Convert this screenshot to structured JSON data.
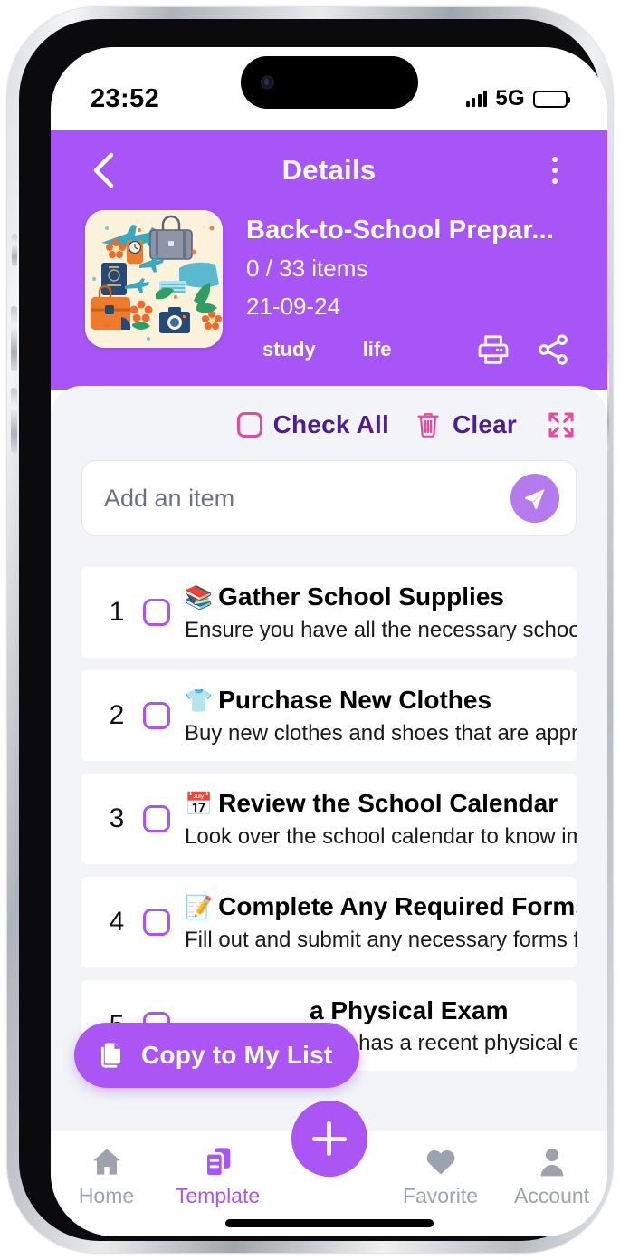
{
  "status_bar": {
    "time": "23:52",
    "network": "5G",
    "signal_icon": "signal-bars-icon",
    "battery_icon": "battery-full-icon"
  },
  "header": {
    "back_icon": "chevron-left-icon",
    "title": "Details",
    "menu_icon": "more-vertical-icon",
    "accent_color": "#a855f7"
  },
  "template": {
    "thumbnail_icon": "travel-pattern-thumbnail",
    "title": "Back-to-School Prepar...",
    "count": "0  / 33 items",
    "date": "21-09-24",
    "tags": [
      "study",
      "life"
    ],
    "print_icon": "printer-icon",
    "share_icon": "share-icon"
  },
  "toolbar": {
    "check_all_label": "Check All",
    "check_all_icon": "checkbox-empty-icon",
    "clear_label": "Clear",
    "clear_icon": "trash-icon",
    "expand_icon": "expand-fullscreen-icon",
    "accent_color": "#ec4899",
    "label_color": "#4c1d95"
  },
  "add_item": {
    "placeholder": "Add an item",
    "value": "",
    "send_icon": "send-paper-plane-icon"
  },
  "items": [
    {
      "num": "1",
      "emoji": "📚",
      "title": "Gather School Supplies",
      "desc": "Ensure you have all the necessary school supplies",
      "checked": false
    },
    {
      "num": "2",
      "emoji": "👕",
      "title": "Purchase New Clothes",
      "desc": "Buy new clothes and shoes that are appropriate fo",
      "checked": false
    },
    {
      "num": "3",
      "emoji": "📅",
      "title": "Review the School Calendar",
      "desc": "Look over the school calendar to know important",
      "checked": false
    },
    {
      "num": "4",
      "emoji": "📝",
      "title": "Complete Any Required Forms",
      "desc": "Fill out and submit any necessary forms for enrollm",
      "checked": false
    },
    {
      "num": "5",
      "emoji": "",
      "title": "a Physical Exam",
      "desc": "Ensure your child has a recent physical exam and",
      "checked": false
    }
  ],
  "copy_button": {
    "label": "Copy to My List",
    "icon": "copy-icon"
  },
  "tabbar": {
    "tabs": [
      {
        "label": "Home",
        "icon": "home-icon",
        "active": false
      },
      {
        "label": "Template",
        "icon": "template-icon",
        "active": true
      },
      {
        "label": "Favorite",
        "icon": "heart-icon",
        "active": false
      },
      {
        "label": "Account",
        "icon": "person-icon",
        "active": false
      }
    ],
    "fab_icon": "plus-icon",
    "active_color": "#a855f7",
    "inactive_color": "#9ca3af"
  }
}
